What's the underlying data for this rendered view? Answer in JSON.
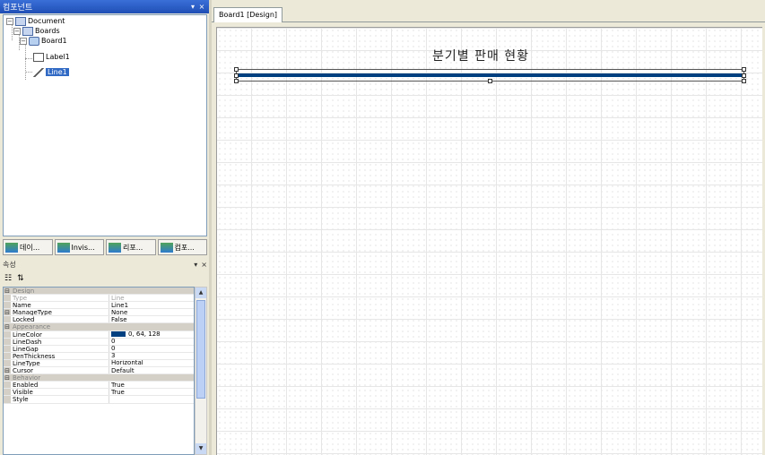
{
  "explorer": {
    "title": "컴포넌트",
    "tree": [
      {
        "label": "Document"
      },
      {
        "label": "Boards"
      },
      {
        "label": "Board1"
      },
      {
        "label": "Label1"
      },
      {
        "label": "Line1"
      }
    ]
  },
  "panel_tabs": [
    {
      "label": "데이..."
    },
    {
      "label": "Invis..."
    },
    {
      "label": "리포..."
    },
    {
      "label": "컴포..."
    }
  ],
  "properties": {
    "title": "속성",
    "rows": [
      {
        "kind": "category",
        "name": "Design"
      },
      {
        "kind": "prop",
        "name": "Type",
        "value": "Line",
        "dim": true
      },
      {
        "kind": "prop",
        "name": "Name",
        "value": "Line1"
      },
      {
        "kind": "prop",
        "name": "ManageType",
        "value": "None",
        "expandable": true
      },
      {
        "kind": "prop",
        "name": "Locked",
        "value": "False"
      },
      {
        "kind": "category",
        "name": "Appearance"
      },
      {
        "kind": "prop",
        "name": "LineColor",
        "value": "0, 64, 128",
        "swatch": "#004080"
      },
      {
        "kind": "prop",
        "name": "LineDash",
        "value": "0"
      },
      {
        "kind": "prop",
        "name": "LineGap",
        "value": "0"
      },
      {
        "kind": "prop",
        "name": "PenThickness",
        "value": "3"
      },
      {
        "kind": "prop",
        "name": "LineType",
        "value": "Horizontal"
      },
      {
        "kind": "prop",
        "name": "Cursor",
        "value": "Default",
        "expandable": true
      },
      {
        "kind": "category",
        "name": "Behavior"
      },
      {
        "kind": "prop",
        "name": "Enabled",
        "value": "True"
      },
      {
        "kind": "prop",
        "name": "Visible",
        "value": "True"
      },
      {
        "kind": "prop",
        "name": "Style",
        "value": ""
      }
    ]
  },
  "document": {
    "tab_label": "Board1 [Design]",
    "report_title": "분기별 판매 현황"
  },
  "colors": {
    "line_color": "#004080",
    "selection": "#316ac5",
    "title_bar": "#2a5cc8"
  }
}
